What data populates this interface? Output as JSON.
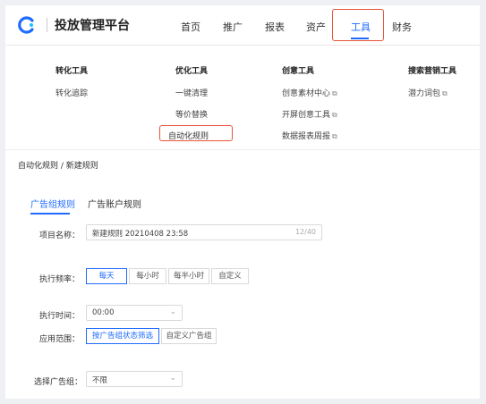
{
  "header": {
    "title": "投放管理平台",
    "nav": [
      "首页",
      "推广",
      "报表",
      "资产",
      "工具",
      "财务"
    ],
    "active": "工具"
  },
  "menu": {
    "col1": {
      "head": "转化工具",
      "items": [
        "转化追踪"
      ]
    },
    "col2": {
      "head": "优化工具",
      "items": [
        "一键清理",
        "等价替换",
        "自动化规则"
      ]
    },
    "col3": {
      "head": "创意工具",
      "items": [
        "创意素材中心",
        "开屏创意工具",
        "数据报表周报"
      ]
    },
    "col4": {
      "head": "搜索营销工具",
      "items": [
        "潜力词包"
      ]
    }
  },
  "breadcrumb": "自动化规则 / 新建规则",
  "tabs": [
    "广告组规则",
    "广告账户规则"
  ],
  "form": {
    "name_label": "项目名称：",
    "name_value": "新建规则 20210408 23:58",
    "name_counter": "12/40",
    "freq_label": "执行频率：",
    "freq_options": [
      "每天",
      "每小时",
      "每半小时",
      "自定义"
    ],
    "time_label": "执行时间：",
    "time_value": "00:00",
    "scope_label": "应用范围：",
    "scope_options": [
      "按广告组状态筛选",
      "自定义广告组"
    ],
    "status_label": "选择广告组：",
    "status_value": "不限"
  }
}
